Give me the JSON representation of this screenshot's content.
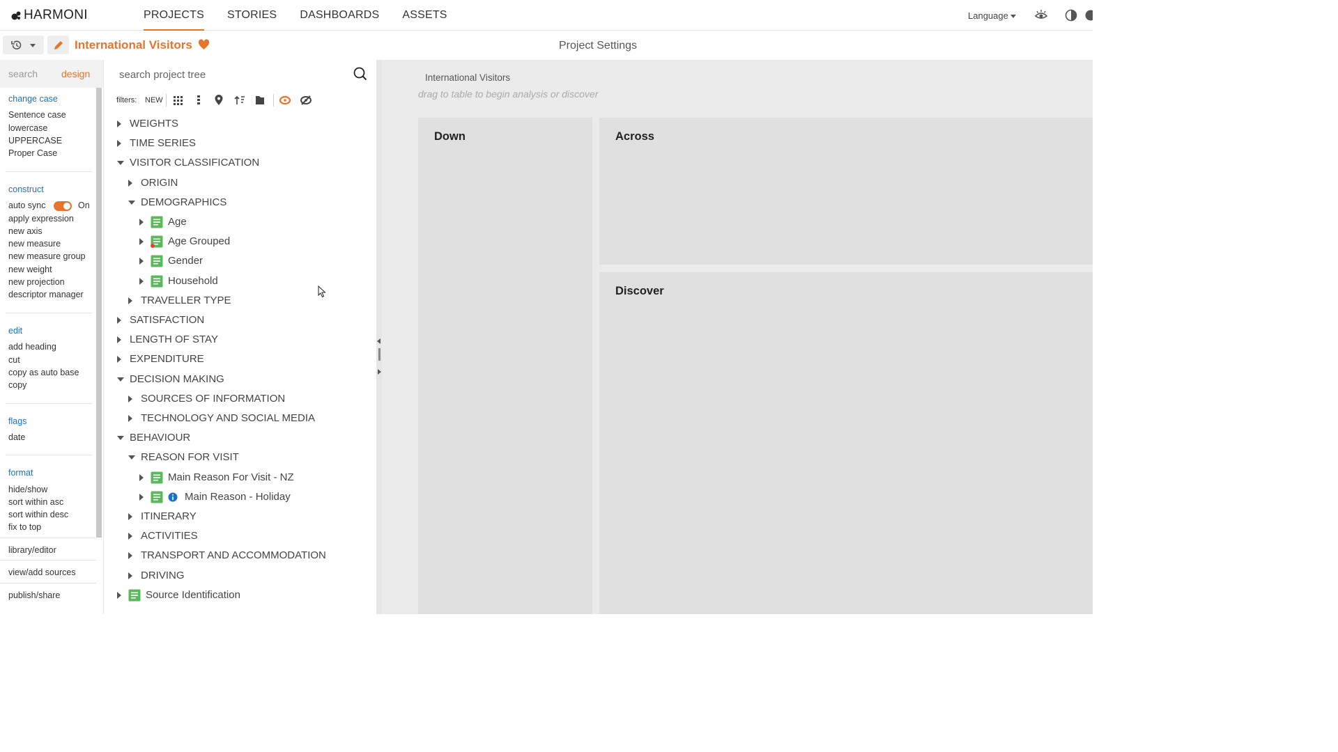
{
  "app": {
    "logo_text": "HARMONI"
  },
  "nav": {
    "tabs": [
      {
        "label": "PROJECTS",
        "active": true
      },
      {
        "label": "STORIES",
        "active": false
      },
      {
        "label": "DASHBOARDS",
        "active": false
      },
      {
        "label": "ASSETS",
        "active": false
      }
    ],
    "language_label": "Language"
  },
  "project": {
    "title": "International Visitors",
    "settings_title": "Project Settings"
  },
  "sidebar": {
    "tabs": [
      "search",
      "design"
    ],
    "active_tab": "design",
    "sections": {
      "change_case": {
        "title": "change case",
        "items": [
          "Sentence case",
          "lowercase",
          "UPPERCASE",
          "Proper Case"
        ]
      },
      "construct": {
        "title": "construct",
        "auto_sync_label": "auto sync",
        "auto_sync_state": "On",
        "items": [
          "apply expression",
          "new axis",
          "new measure",
          "new measure group",
          "new weight",
          "new projection",
          "descriptor manager"
        ]
      },
      "edit": {
        "title": "edit",
        "items": [
          "add heading",
          "cut",
          "copy as auto base",
          "copy"
        ]
      },
      "flags": {
        "title": "flags",
        "items": [
          "date"
        ]
      },
      "format": {
        "title": "format",
        "items": [
          "hide/show",
          "sort within asc",
          "sort within desc",
          "fix to top"
        ]
      }
    },
    "bottom_links": [
      "library/editor",
      "view/add sources",
      "publish/share"
    ]
  },
  "tree": {
    "search_placeholder": "search project tree",
    "filters_label": "filters:",
    "filters_new": "NEW",
    "items": [
      {
        "label": "WEIGHTS",
        "level": 0,
        "expanded": false
      },
      {
        "label": "TIME SERIES",
        "level": 0,
        "expanded": false
      },
      {
        "label": "VISITOR CLASSIFICATION",
        "level": 0,
        "expanded": true
      },
      {
        "label": "ORIGIN",
        "level": 1,
        "expanded": false
      },
      {
        "label": "DEMOGRAPHICS",
        "level": 1,
        "expanded": true
      },
      {
        "label": "Age",
        "level": 2,
        "expanded": false,
        "variable": true
      },
      {
        "label": "Age Grouped",
        "level": 2,
        "expanded": false,
        "variable": true,
        "flag": "red-dot"
      },
      {
        "label": "Gender",
        "level": 2,
        "expanded": false,
        "variable": true
      },
      {
        "label": "Household",
        "level": 2,
        "expanded": false,
        "variable": true
      },
      {
        "label": "TRAVELLER TYPE",
        "level": 1,
        "expanded": false
      },
      {
        "label": "SATISFACTION",
        "level": 0,
        "expanded": false
      },
      {
        "label": "LENGTH OF STAY",
        "level": 0,
        "expanded": false
      },
      {
        "label": "EXPENDITURE",
        "level": 0,
        "expanded": false
      },
      {
        "label": "DECISION MAKING",
        "level": 0,
        "expanded": true
      },
      {
        "label": "SOURCES OF INFORMATION",
        "level": 1,
        "expanded": false
      },
      {
        "label": "TECHNOLOGY AND SOCIAL MEDIA",
        "level": 1,
        "expanded": false
      },
      {
        "label": "BEHAVIOUR",
        "level": 0,
        "expanded": true
      },
      {
        "label": "REASON FOR VISIT",
        "level": 1,
        "expanded": true
      },
      {
        "label": "Main Reason For Visit - NZ",
        "level": 2,
        "expanded": false,
        "variable": true
      },
      {
        "label": "Main Reason - Holiday",
        "level": 2,
        "expanded": false,
        "variable": true,
        "flag": "info"
      },
      {
        "label": "ITINERARY",
        "level": 1,
        "expanded": false
      },
      {
        "label": "ACTIVITIES",
        "level": 1,
        "expanded": false
      },
      {
        "label": "TRANSPORT AND ACCOMMODATION",
        "level": 1,
        "expanded": false
      },
      {
        "label": "DRIVING",
        "level": 1,
        "expanded": false
      },
      {
        "label": "Source Identification",
        "level": 0,
        "expanded": false,
        "variable": true
      }
    ]
  },
  "main": {
    "title": "International Visitors",
    "hint": "drag to table to begin analysis or discover",
    "zones": {
      "down": "Down",
      "across": "Across",
      "discover": "Discover"
    }
  },
  "colors": {
    "accent": "#e8732a",
    "link": "#1a73c4",
    "variable_icon": "#5cb85c"
  }
}
